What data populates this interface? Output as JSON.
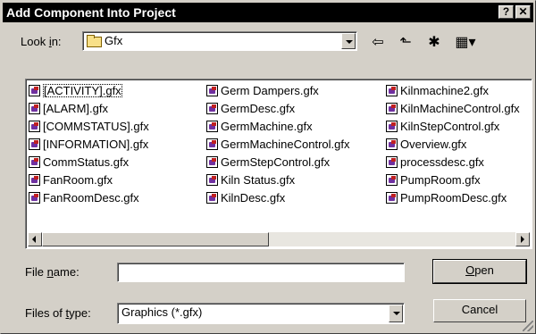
{
  "dialog": {
    "title": "Add Component Into Project",
    "help_glyph": "?",
    "close_glyph": "✕"
  },
  "lookin": {
    "label_pre": "Look ",
    "label_accel": "i",
    "label_post": "n:",
    "value": "Gfx",
    "icon": "folder-icon"
  },
  "toolbar": {
    "back_icon": "back-arrow-icon",
    "up_icon": "up-folder-icon",
    "new_folder_icon": "new-folder-icon",
    "view_menu_icon": "view-menu-icon",
    "back_glyph": "⇦",
    "up_glyph": "⬑",
    "new_glyph": "✱",
    "view_glyph": "▦▾"
  },
  "files": {
    "col1": [
      "[ACTIVITY].gfx",
      "[ALARM].gfx",
      "[COMMSTATUS].gfx",
      "[INFORMATION].gfx",
      "CommStatus.gfx",
      "FanRoom.gfx",
      "FanRoomDesc.gfx"
    ],
    "col2": [
      "Germ Dampers.gfx",
      "GermDesc.gfx",
      "GermMachine.gfx",
      "GermMachineControl.gfx",
      "GermStepControl.gfx",
      "Kiln Status.gfx",
      "KilnDesc.gfx"
    ],
    "col3": [
      "Kilnmachine2.gfx",
      "KilnMachineControl.gfx",
      "KilnStepControl.gfx",
      "Overview.gfx",
      "processdesc.gfx",
      "PumpRoom.gfx",
      "PumpRoomDesc.gfx"
    ]
  },
  "filename": {
    "label_pre": "File ",
    "label_accel": "n",
    "label_post": "ame:",
    "value": ""
  },
  "filetype": {
    "label_pre": "Files of ",
    "label_accel": "t",
    "label_post": "ype:",
    "value": "Graphics (*.gfx)"
  },
  "buttons": {
    "open_accel": "O",
    "open_rest": "pen",
    "cancel": "Cancel"
  }
}
